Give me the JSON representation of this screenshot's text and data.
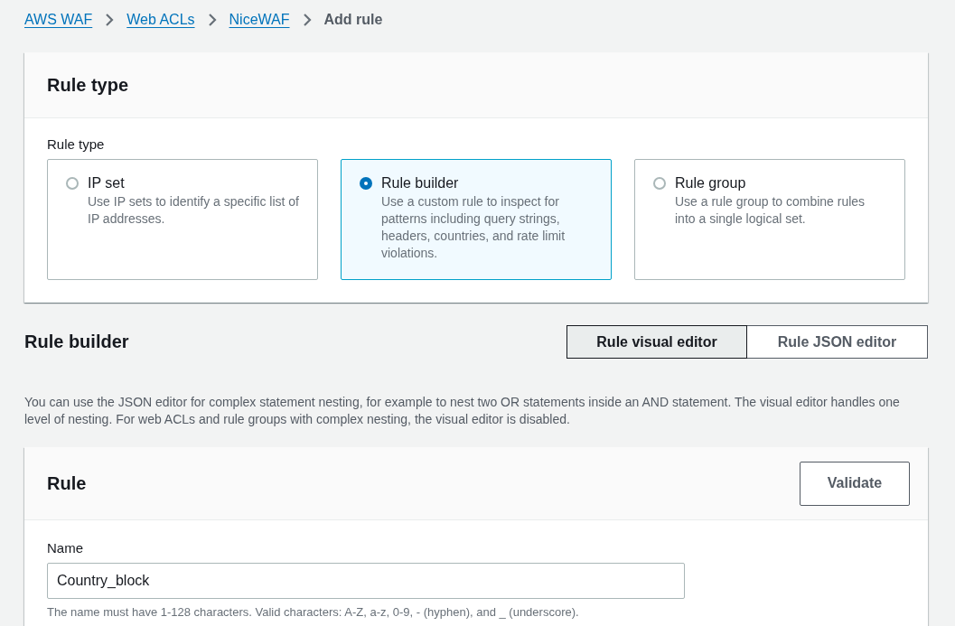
{
  "breadcrumbs": [
    {
      "label": "AWS WAF",
      "kind": "link"
    },
    {
      "label": "Web ACLs",
      "kind": "link"
    },
    {
      "label": "NiceWAF",
      "kind": "link"
    },
    {
      "label": "Add rule",
      "kind": "current"
    }
  ],
  "rule_type_panel": {
    "title": "Rule type",
    "field_label": "Rule type",
    "options": [
      {
        "title": "IP set",
        "description": "Use IP sets to identify a specific list of IP addresses.",
        "selected": false
      },
      {
        "title": "Rule builder",
        "description": "Use a custom rule to inspect for patterns including query strings, headers, countries, and rate limit violations.",
        "selected": true
      },
      {
        "title": "Rule group",
        "description": "Use a rule group to combine rules into a single logical set.",
        "selected": false
      }
    ]
  },
  "rule_builder": {
    "title": "Rule builder",
    "editor_tabs": [
      {
        "label": "Rule visual editor",
        "selected": true
      },
      {
        "label": "Rule JSON editor",
        "selected": false
      }
    ],
    "description": "You can use the JSON editor for complex statement nesting, for example to nest two OR statements inside an AND statement. The visual editor handles one level of nesting. For web ACLs and rule groups with complex nesting, the visual editor is disabled."
  },
  "rule_panel": {
    "title": "Rule",
    "button": "Validate",
    "name_label": "Name",
    "name_value": "Country_block",
    "name_hint": "The name must have 1-128 characters. Valid characters: A-Z, a-z, 0-9, - (hyphen), and _ (underscore)."
  }
}
